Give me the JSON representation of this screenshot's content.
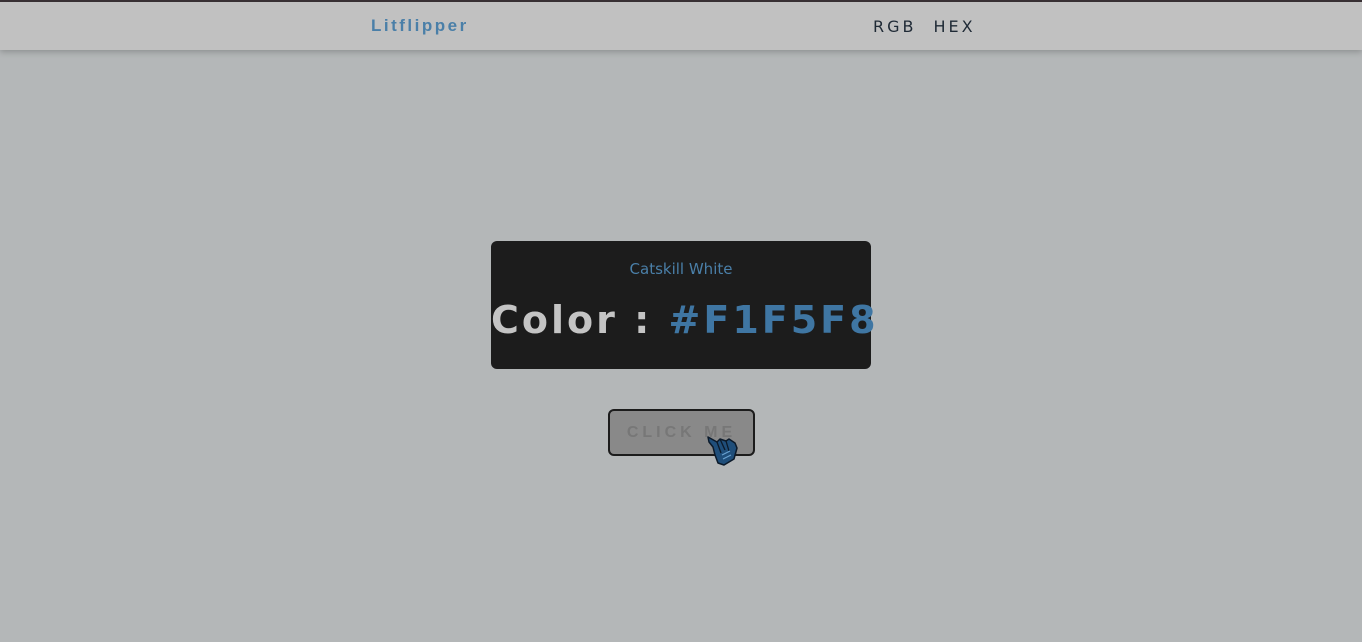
{
  "navbar": {
    "brand": "Litflipper",
    "links": [
      "RGB",
      "HEX"
    ]
  },
  "card": {
    "color_name": "Catskill White",
    "label": "Color :",
    "value": "#F1F5F8"
  },
  "button": {
    "label": "CLICK ME"
  },
  "icons": {
    "cursor": "pointing-hand-cursor-icon"
  },
  "colors": {
    "page_background": "#b4b7b8",
    "navbar_background": "#c1c1c1",
    "accent": "#4a7fa8",
    "card_background": "#1c1c1c",
    "button_background": "#898989"
  }
}
